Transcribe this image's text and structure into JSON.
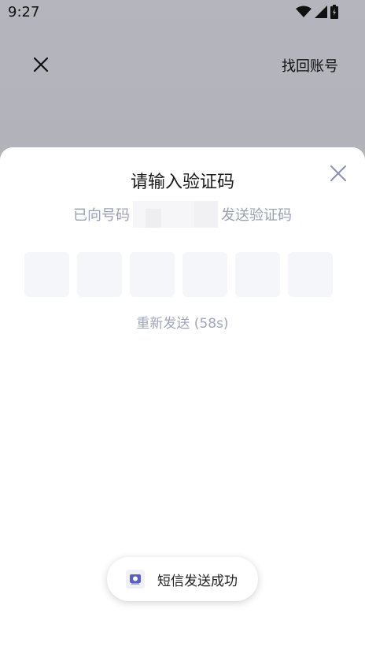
{
  "status_bar": {
    "time": "9:27"
  },
  "background_page": {
    "close_icon": "close-icon",
    "recover_account_label": "找回账号"
  },
  "sheet": {
    "title": "请输入验证码",
    "subtitle_prefix": "已向号码",
    "subtitle_suffix": "发送验证码",
    "code_length": 6,
    "resend_label": "重新发送 (58s)",
    "close_icon": "close-icon"
  },
  "toast": {
    "text": "短信发送成功",
    "icon": "app-icon"
  },
  "colors": {
    "accent": "#8a8fb8",
    "muted_text": "#9aa0b4",
    "code_box_bg": "#f5f6f9"
  }
}
